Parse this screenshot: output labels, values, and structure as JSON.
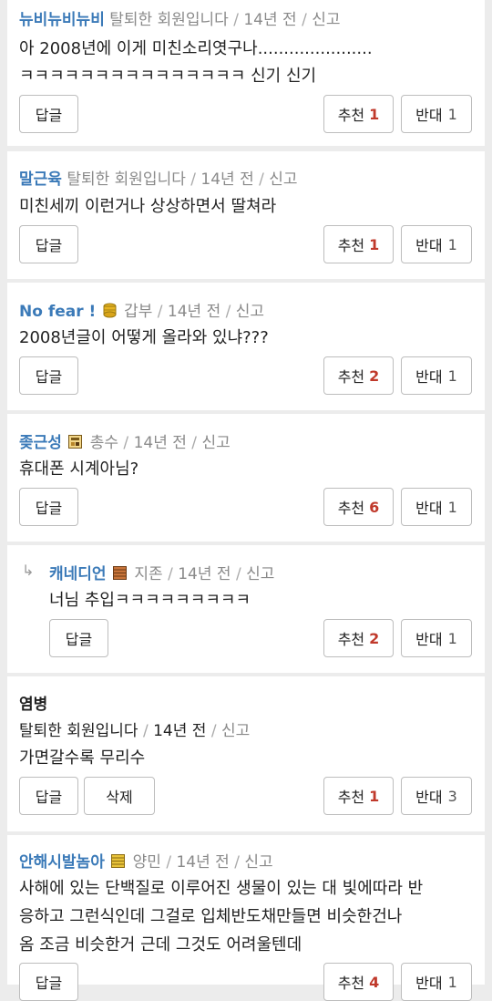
{
  "comments": [
    {
      "nick": "뉴비뉴비뉴비",
      "grade": "탈퇴한 회원입니다",
      "time": "14년 전",
      "report": "신고",
      "lines": [
        "아 2008년에 이게 미친소리엿구나......................",
        "ㅋㅋㅋㅋㅋㅋㅋㅋㅋㅋㅋㅋㅋㅋㅋ 신기 신기"
      ],
      "reply": "답글",
      "up_label": "추천",
      "up": "1",
      "down_label": "반대",
      "down": "1"
    },
    {
      "nick": "말근육",
      "grade": "탈퇴한 회원입니다",
      "time": "14년 전",
      "report": "신고",
      "lines": [
        "미친세끼 이런거나 상상하면서 딸쳐라"
      ],
      "reply": "답글",
      "up_label": "추천",
      "up": "1",
      "down_label": "반대",
      "down": "1"
    },
    {
      "nick": "No fear !",
      "grade": "갑부",
      "grade_icon": "coin-stack-icon",
      "time": "14년 전",
      "report": "신고",
      "lines": [
        "2008년글이 어떻게 올라와 있냐???"
      ],
      "reply": "답글",
      "up_label": "추천",
      "up": "2",
      "down_label": "반대",
      "down": "1"
    },
    {
      "nick": "좆근성",
      "grade": "총수",
      "grade_icon": "boss-badge-icon",
      "time": "14년 전",
      "report": "신고",
      "lines": [
        "휴대폰 시계아님?"
      ],
      "reply": "답글",
      "up_label": "추천",
      "up": "6",
      "down_label": "반대",
      "down": "1"
    },
    {
      "nick": "캐네디언",
      "grade": "지존",
      "grade_icon": "brick-badge-icon",
      "time": "14년 전",
      "report": "신고",
      "lines": [
        "너님 추입ㅋㅋㅋㅋㅋㅋㅋㅋㅋ"
      ],
      "reply": "답글",
      "up_label": "추천",
      "up": "2",
      "down_label": "반대",
      "down": "1"
    },
    {
      "nick": "염병",
      "grade": "탈퇴한 회원입니다",
      "time": "14년 전",
      "report": "신고",
      "lines": [
        "가면갈수록 무리수"
      ],
      "reply": "답글",
      "delete": "삭제",
      "up_label": "추천",
      "up": "1",
      "down_label": "반대",
      "down": "3"
    },
    {
      "nick": "안해시발놈아",
      "grade": "양민",
      "grade_icon": "gold-bars-icon",
      "time": "14년 전",
      "report": "신고",
      "lines": [
        "사해에 있는 단백질로 이루어진 생물이 있는 대 빛에따라 반",
        "응하고 그런식인데 그걸로 입체반도채만들면 비슷한건나",
        "옴 조금 비슷한거 근데 그것도 어려울텐데"
      ],
      "reply": "답글",
      "up_label": "추천",
      "up": "4",
      "down_label": "반대",
      "down": "1"
    }
  ],
  "colors": {
    "nick": "#3b7ab8",
    "upvote": "#c0392b",
    "background": "#ececec"
  }
}
